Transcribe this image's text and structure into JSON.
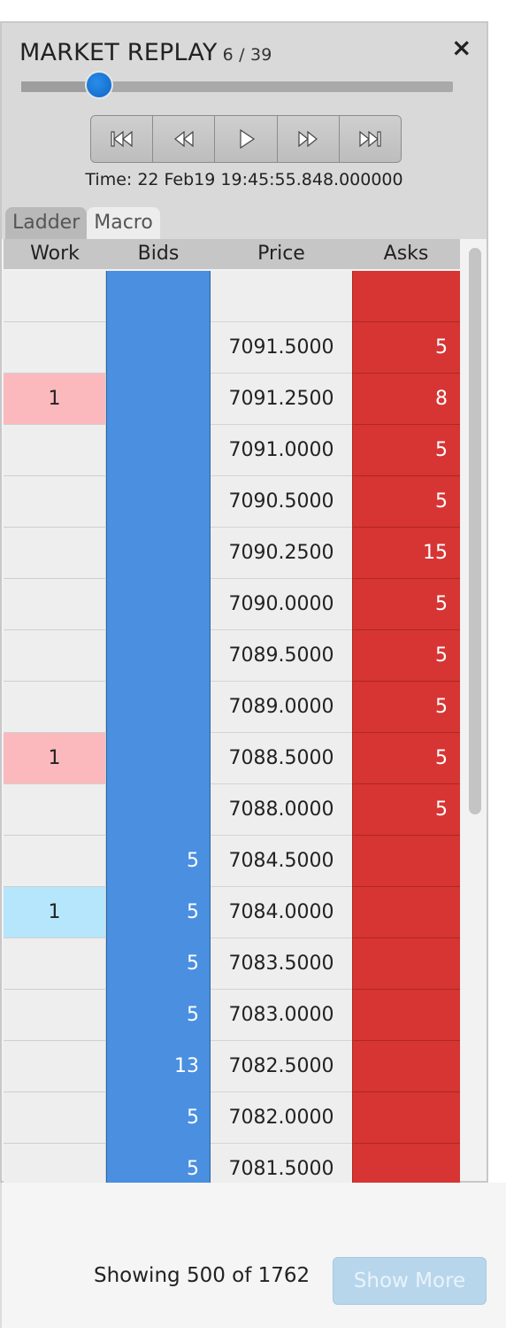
{
  "header": {
    "title": "MARKET REPLAY",
    "step": "6 / 39",
    "close_icon": "×",
    "slider_progress": 0.18,
    "time": "Time: 22 Feb19 19:45:55.848.000000"
  },
  "controls": [
    {
      "icon": "skip-to-start-icon"
    },
    {
      "icon": "rewind-icon"
    },
    {
      "icon": "play-icon"
    },
    {
      "icon": "fast-forward-icon"
    },
    {
      "icon": "skip-to-end-icon"
    }
  ],
  "tabs": [
    {
      "label": "Ladder",
      "active": false
    },
    {
      "label": "Macro",
      "active": true
    }
  ],
  "columns": {
    "work": "Work",
    "bids": "Bids",
    "price": "Price",
    "asks": "Asks"
  },
  "rows": [
    {
      "work": "",
      "work_side": "",
      "bids": "",
      "price": "",
      "asks": ""
    },
    {
      "work": "",
      "work_side": "",
      "bids": "",
      "price": "7091.5000",
      "asks": "5"
    },
    {
      "work": "1",
      "work_side": "sell",
      "bids": "",
      "price": "7091.2500",
      "asks": "8"
    },
    {
      "work": "",
      "work_side": "",
      "bids": "",
      "price": "7091.0000",
      "asks": "5"
    },
    {
      "work": "",
      "work_side": "",
      "bids": "",
      "price": "7090.5000",
      "asks": "5"
    },
    {
      "work": "",
      "work_side": "",
      "bids": "",
      "price": "7090.2500",
      "asks": "15"
    },
    {
      "work": "",
      "work_side": "",
      "bids": "",
      "price": "7090.0000",
      "asks": "5"
    },
    {
      "work": "",
      "work_side": "",
      "bids": "",
      "price": "7089.5000",
      "asks": "5"
    },
    {
      "work": "",
      "work_side": "",
      "bids": "",
      "price": "7089.0000",
      "asks": "5"
    },
    {
      "work": "1",
      "work_side": "sell",
      "bids": "",
      "price": "7088.5000",
      "asks": "5"
    },
    {
      "work": "",
      "work_side": "",
      "bids": "",
      "price": "7088.0000",
      "asks": "5"
    },
    {
      "work": "",
      "work_side": "",
      "bids": "5",
      "price": "7084.5000",
      "asks": ""
    },
    {
      "work": "1",
      "work_side": "buy",
      "bids": "5",
      "price": "7084.0000",
      "asks": ""
    },
    {
      "work": "",
      "work_side": "",
      "bids": "5",
      "price": "7083.5000",
      "asks": ""
    },
    {
      "work": "",
      "work_side": "",
      "bids": "5",
      "price": "7083.0000",
      "asks": ""
    },
    {
      "work": "",
      "work_side": "",
      "bids": "13",
      "price": "7082.5000",
      "asks": ""
    },
    {
      "work": "",
      "work_side": "",
      "bids": "5",
      "price": "7082.0000",
      "asks": ""
    },
    {
      "work": "",
      "work_side": "",
      "bids": "5",
      "price": "7081.5000",
      "asks": ""
    }
  ],
  "footer": {
    "showing": "Showing 500 of 1762",
    "show_more": "Show More"
  },
  "colors": {
    "bids": "#4a8fe0",
    "asks": "#d63533",
    "work_sell": "#fbb9bd",
    "work_buy": "#b6e6fb",
    "slider_thumb": "#1479d9"
  }
}
